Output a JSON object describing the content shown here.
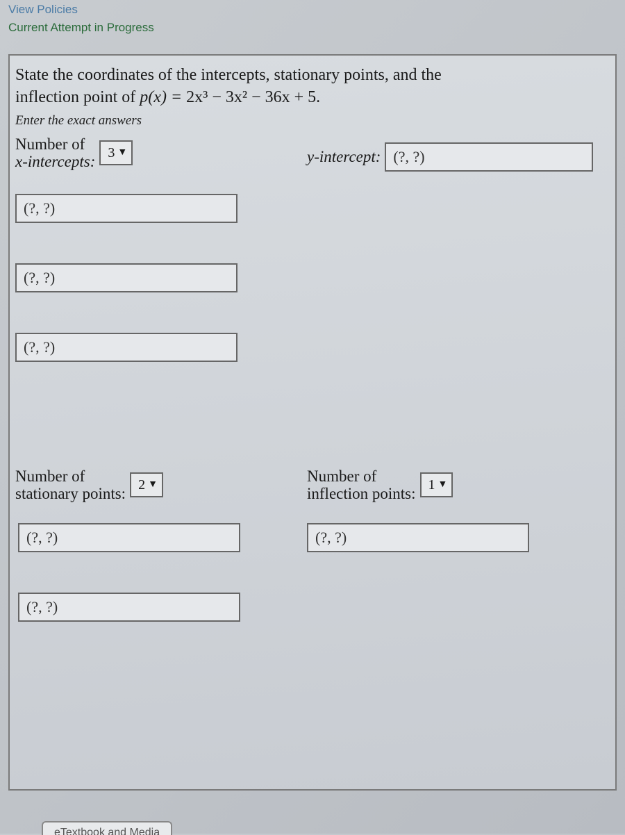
{
  "links": {
    "view_policies": "View Policies",
    "current_attempt": "Current Attempt in Progress"
  },
  "problem": {
    "line1": "State the coordinates of the intercepts, stationary points, and the",
    "line2_prefix": "inflection point of ",
    "func_lhs": "p(x) = ",
    "func_rhs": "2x³ − 3x² − 36x + 5.",
    "instruction": "Enter the exact answers"
  },
  "xint": {
    "label_line1": "Number of",
    "label_line2": "x-intercepts:",
    "value": "3",
    "inputs": [
      "(?, ?)",
      "(?, ?)",
      "(?, ?)"
    ]
  },
  "yint": {
    "label": "y-intercept:",
    "value": "(?, ?)"
  },
  "stationary": {
    "label_line1": "Number of",
    "label_line2": "stationary points:",
    "value": "2",
    "inputs": [
      "(?, ?)",
      "(?, ?)"
    ]
  },
  "inflection": {
    "label_line1": "Number of",
    "label_line2": "inflection points:",
    "value": "1",
    "inputs": [
      "(?, ?)"
    ]
  },
  "footer": {
    "etextbook": "eTextbook and Media"
  },
  "glyphs": {
    "caret": "▼"
  }
}
